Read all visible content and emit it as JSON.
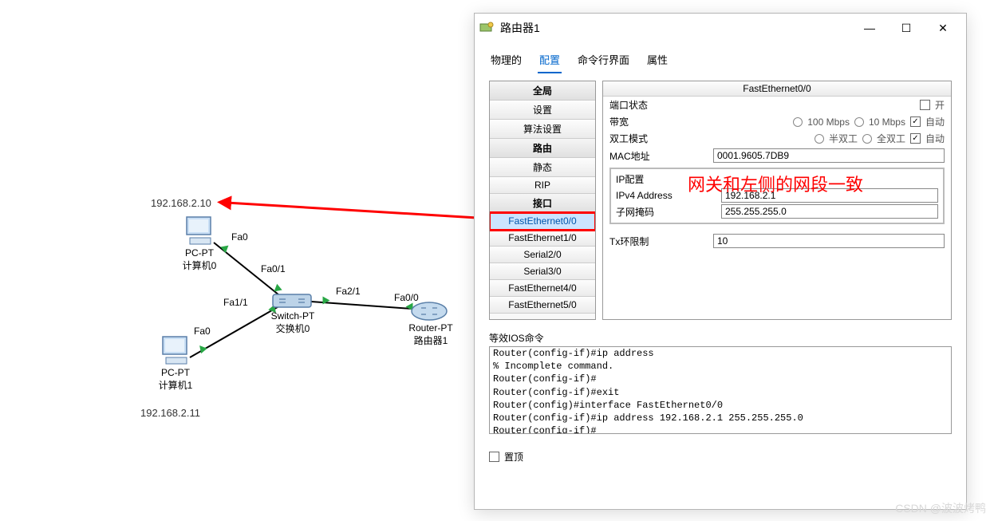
{
  "topology": {
    "pc0": {
      "ip": "192.168.2.10",
      "model": "PC-PT",
      "name": "计算机0",
      "port": "Fa0"
    },
    "pc1": {
      "ip": "192.168.2.11",
      "model": "PC-PT",
      "name": "计算机1",
      "port": "Fa0"
    },
    "switch0": {
      "model": "Switch-PT",
      "name": "交换机0",
      "port_pc0": "Fa0/1",
      "port_pc1": "Fa1/1",
      "port_router": "Fa2/1"
    },
    "router1": {
      "model": "Router-PT",
      "name": "路由器1",
      "port": "Fa0/0"
    }
  },
  "annotation": "网关和左侧的网段一致",
  "dialog": {
    "title": "路由器1",
    "tabs": [
      "物理的",
      "配置",
      "命令行界面",
      "属性"
    ],
    "active_tab": 1,
    "sidebar": {
      "groups": [
        {
          "header": "全局",
          "items": [
            "设置",
            "算法设置"
          ]
        },
        {
          "header": "路由",
          "items": [
            "静态",
            "RIP"
          ]
        },
        {
          "header": "接口",
          "items": [
            "FastEthernet0/0",
            "FastEthernet1/0",
            "Serial2/0",
            "Serial3/0",
            "FastEthernet4/0",
            "FastEthernet5/0"
          ]
        }
      ],
      "selected": "FastEthernet0/0"
    },
    "panel": {
      "title": "FastEthernet0/0",
      "port_status": {
        "label": "端口状态",
        "on_label": "开",
        "checked": false
      },
      "bandwidth": {
        "label": "带宽",
        "opt1": "100 Mbps",
        "opt2": "10 Mbps",
        "auto_label": "自动",
        "auto_checked": true
      },
      "duplex": {
        "label": "双工模式",
        "opt1": "半双工",
        "opt2": "全双工",
        "auto_label": "自动",
        "auto_checked": true
      },
      "mac": {
        "label": "MAC地址",
        "value": "0001.9605.7DB9"
      },
      "ip_group": {
        "title": "IP配置",
        "ipv4_label": "IPv4 Address",
        "ipv4_value": "192.168.2.1",
        "mask_label": "子网掩码",
        "mask_value": "255.255.255.0"
      },
      "tx_ring": {
        "label": "Tx环限制",
        "value": "10"
      }
    },
    "ios": {
      "label": "等效IOS命令",
      "lines": "Router(config-if)#ip address\n% Incomplete command.\nRouter(config-if)#\nRouter(config-if)#exit\nRouter(config)#interface FastEthernet0/0\nRouter(config-if)#ip address 192.168.2.1 255.255.255.0\nRouter(config-if)#"
    },
    "pin_top": "置顶"
  },
  "watermark": "CSDN @波波烤鸭"
}
